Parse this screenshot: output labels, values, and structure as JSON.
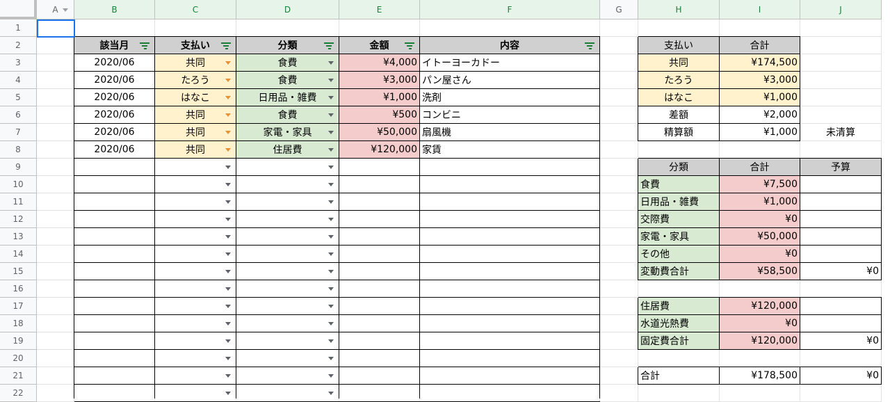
{
  "columns": [
    "A",
    "B",
    "C",
    "D",
    "E",
    "F",
    "G",
    "H",
    "I",
    "J"
  ],
  "rows": [
    "1",
    "2",
    "3",
    "4",
    "5",
    "6",
    "7",
    "8",
    "9",
    "10",
    "11",
    "12",
    "13",
    "14",
    "15",
    "16",
    "17",
    "18",
    "19",
    "20",
    "21",
    "22"
  ],
  "colors": {
    "header_gray": "#d0d0d0",
    "yellow": "#fff2cc",
    "green": "#d9ead3",
    "red": "#f4cccc",
    "dropdown_orange": "#e69138",
    "dropdown_gray": "#5f6368",
    "filter_green": "#188038",
    "selection_blue": "#1a73e8"
  },
  "main_table": {
    "headers": [
      "該当月",
      "支払い",
      "分類",
      "金額",
      "内容"
    ],
    "rows": [
      [
        "2020/06",
        "共同",
        "食費",
        "¥4,000",
        "イトーヨーカドー"
      ],
      [
        "2020/06",
        "たろう",
        "食費",
        "¥3,000",
        "パン屋さん"
      ],
      [
        "2020/06",
        "はなこ",
        "日用品・雑費",
        "¥1,000",
        "洗剤"
      ],
      [
        "2020/06",
        "共同",
        "食費",
        "¥500",
        "コンビニ"
      ],
      [
        "2020/06",
        "共同",
        "家電・家具",
        "¥50,000",
        "扇風機"
      ],
      [
        "2020/06",
        "共同",
        "住居費",
        "¥120,000",
        "家賃"
      ]
    ]
  },
  "payment_summary": {
    "headers": [
      "支払い",
      "合計"
    ],
    "rows": [
      [
        "共同",
        "¥174,500",
        ""
      ],
      [
        "たろう",
        "¥3,000",
        ""
      ],
      [
        "はなこ",
        "¥1,000",
        ""
      ],
      [
        "差額",
        "¥2,000",
        ""
      ],
      [
        "精算額",
        "¥1,000",
        "未清算"
      ]
    ]
  },
  "category_summary": {
    "headers": [
      "分類",
      "合計",
      "予算"
    ],
    "rows": [
      [
        "食費",
        "¥7,500",
        ""
      ],
      [
        "日用品・雑費",
        "¥1,000",
        ""
      ],
      [
        "交際費",
        "¥0",
        ""
      ],
      [
        "家電・家具",
        "¥50,000",
        ""
      ],
      [
        "その他",
        "¥0",
        ""
      ],
      [
        "変動費合計",
        "¥58,500",
        "¥0"
      ]
    ]
  },
  "fixed_summary": {
    "rows": [
      [
        "住居費",
        "¥120,000",
        ""
      ],
      [
        "水道光熱費",
        "¥0",
        ""
      ],
      [
        "固定費合計",
        "¥120,000",
        "¥0"
      ]
    ]
  },
  "total_row": [
    "合計",
    "¥178,500",
    "¥0"
  ]
}
